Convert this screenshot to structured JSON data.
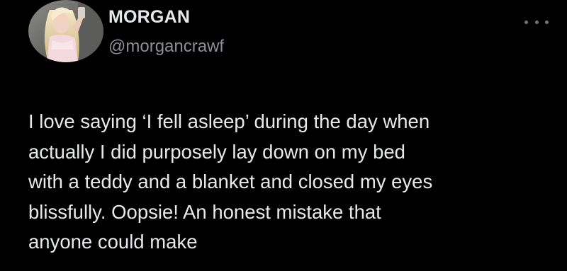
{
  "author": {
    "display_name": "MORGAN",
    "handle": "@morgancrawf",
    "avatar_icon": "profile-photo"
  },
  "menu": {
    "more_icon": "more-horizontal-icon"
  },
  "tweet": {
    "lines": [
      "I love saying ‘I fell asleep’ during the day when",
      "actually I did purposely lay down on my bed",
      "with a teddy and a blanket and closed my eyes",
      "blissfully. Oopsie! An honest mistake that",
      "anyone could make"
    ]
  },
  "colors": {
    "background": "#000000",
    "text": "#e7e9ea",
    "secondary_text": "#8b9095"
  }
}
